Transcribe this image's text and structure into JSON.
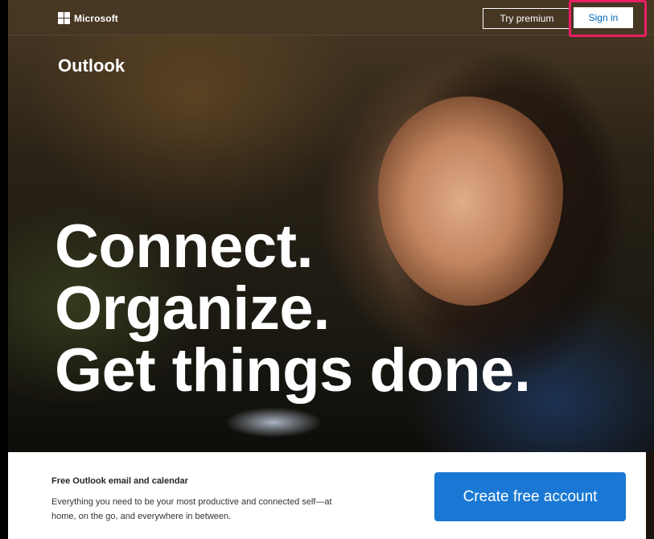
{
  "brand": {
    "logo_text": "Microsoft",
    "logo_icon": "microsoft-logo-icon"
  },
  "header": {
    "try_premium_label": "Try premium",
    "sign_in_label": "Sign in"
  },
  "product": {
    "name": "Outlook"
  },
  "hero": {
    "headline_lines": [
      "Connect.",
      "Organize.",
      "Get things done."
    ]
  },
  "card": {
    "title": "Free Outlook email and calendar",
    "description": "Everything you need to be your most productive and connected self—at home, on the go, and everywhere in between.",
    "create_account_label": "Create free account"
  },
  "colors": {
    "primary_button": "#1a78d4",
    "sign_in_text": "#0067b8",
    "highlight": "#e91e63"
  }
}
